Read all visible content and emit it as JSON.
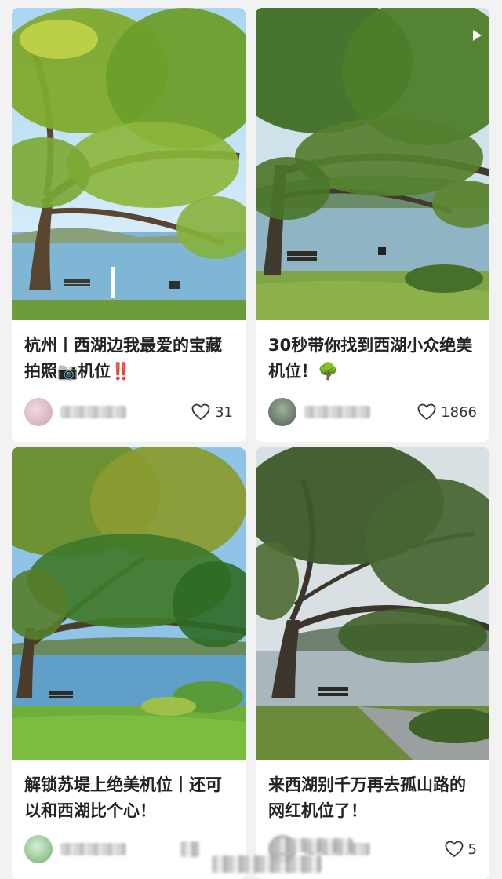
{
  "feed": {
    "posts": [
      {
        "title": "杭州丨西湖边我最爱的宝藏拍照📷机位‼️",
        "likes": "31",
        "is_video": false
      },
      {
        "title": "30秒带你找到西湖小众绝美机位！🌳",
        "likes": "1866",
        "is_video": true
      },
      {
        "title": "解锁苏堤上绝美机位丨还可以和西湖比个心！",
        "likes": "",
        "is_video": false
      },
      {
        "title": "来西湖别千万再去孤山路的网红机位了！",
        "likes": "5",
        "is_video": false
      }
    ]
  },
  "icons": {
    "like": "heart-outline-icon",
    "video": "play-icon"
  },
  "colors": {
    "background": "#f2f2f2",
    "card": "#ffffff",
    "title_text": "#222222",
    "meta_text": "#333333"
  }
}
